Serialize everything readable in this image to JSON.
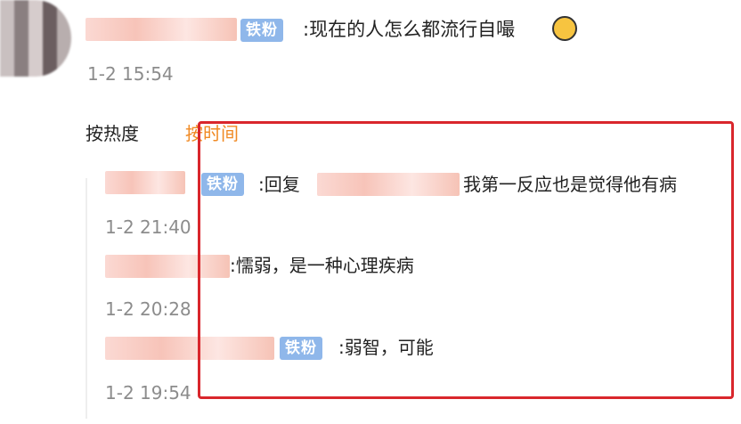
{
  "comment": {
    "badge": "铁粉",
    "text": ":现在的人怎么都流行自嘬",
    "time": "1-2 15:54"
  },
  "sort": {
    "hot": "按热度",
    "time": "按时间"
  },
  "replies": [
    {
      "badge": "铁粉",
      "text": ":回复",
      "text2": "我第一反应也是觉得他有病",
      "time": "1-2 21:40"
    },
    {
      "text": ":懦弱，是一种心理疾病",
      "time": "1-2 20:28"
    },
    {
      "badge": "铁粉",
      "text": ":弱智，可能",
      "time": "1-2 19:54"
    }
  ],
  "colors": {
    "badge": "#8fb7ea",
    "sort_active": "#f08a24",
    "highlight_border": "#d9262c"
  }
}
